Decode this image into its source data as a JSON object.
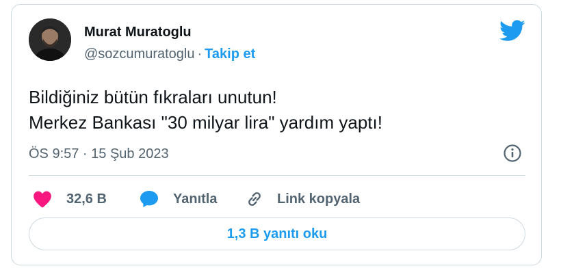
{
  "author": {
    "display_name": "Murat Muratoglu",
    "handle": "@sozcumuratoglu",
    "separator": "·",
    "follow_label": "Takip et",
    "avatar_icon": "profile-photo"
  },
  "brand_icon": "twitter-bird-icon",
  "tweet": {
    "lines": [
      "Bildiğiniz bütün fıkraları unutun!",
      "Merkez Bankası \"30 milyar lira\" yardım yaptı!"
    ],
    "timestamp": "ÖS 9:57 · 15 Şub 2023"
  },
  "actions": {
    "like_count": "32,6 B",
    "reply_label": "Yanıtla",
    "copy_link_label": "Link kopyala"
  },
  "read_replies_label": "1,3 B yanıtı oku",
  "colors": {
    "accent": "#1d9bf0",
    "like": "#f91880",
    "text": "#0f1419",
    "muted": "#536471",
    "border": "#cfd9de"
  }
}
